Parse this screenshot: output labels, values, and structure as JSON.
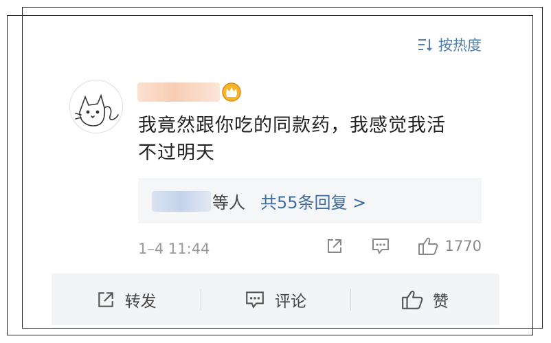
{
  "sort": {
    "label": "按热度"
  },
  "comment": {
    "text_line1": "我竟然跟你吃的同款药，我感觉我活",
    "text_line2": "不过明天",
    "timestamp": "1–4 11:44",
    "like_count": "1770"
  },
  "replies": {
    "users_suffix": "等人",
    "count_label": "共55条回复 >"
  },
  "actions": {
    "repost_label": "转发",
    "comment_label": "评论",
    "like_label": "赞"
  },
  "colors": {
    "link": "#3d6c9e",
    "crown": "#f0a11c"
  }
}
